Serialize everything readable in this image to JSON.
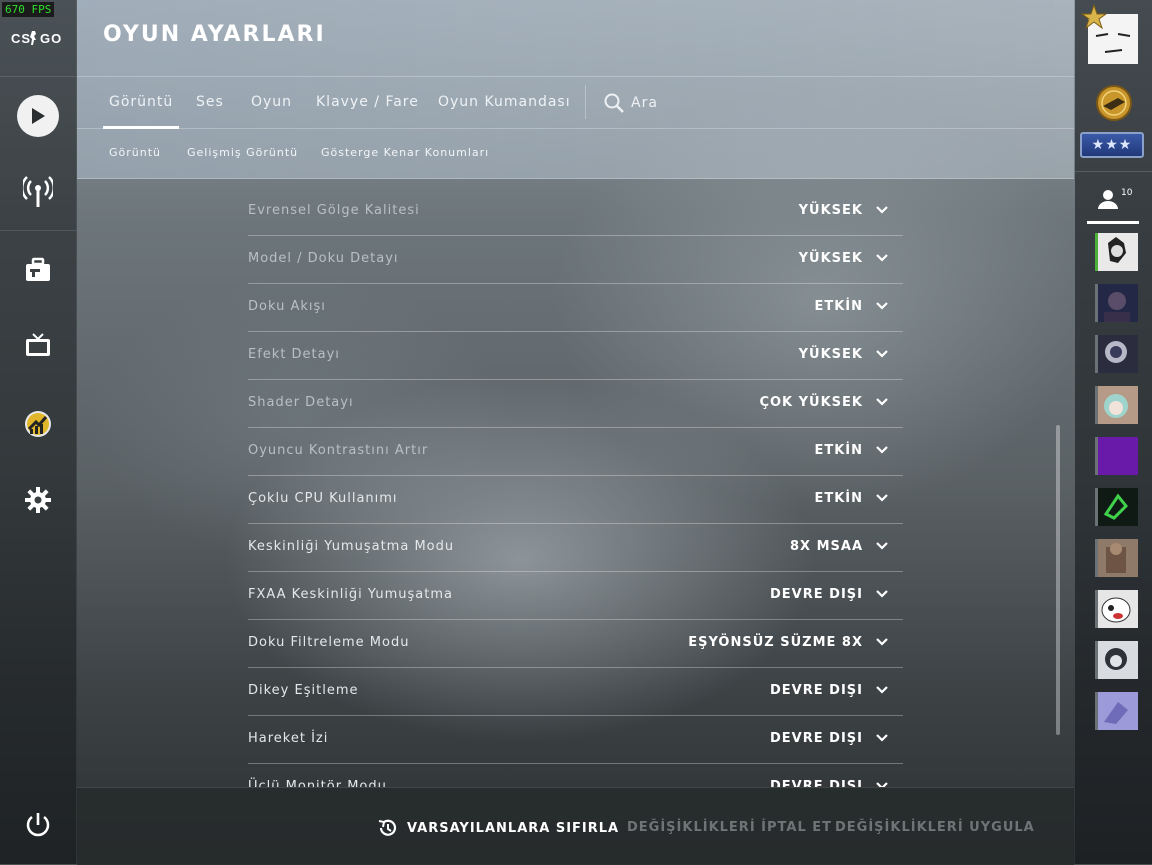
{
  "fps": "670 FPS",
  "logo": "CS GO",
  "header": {
    "title": "OYUN AYARLARI"
  },
  "tabs": [
    {
      "label": "Görüntü",
      "active": true
    },
    {
      "label": "Ses"
    },
    {
      "label": "Oyun"
    },
    {
      "label": "Klavye / Fare"
    },
    {
      "label": "Oyun Kumandası"
    }
  ],
  "search": {
    "label": "Ara"
  },
  "subtabs": [
    "Görüntü",
    "Gelişmiş Görüntü",
    "Gösterge Kenar Konumları"
  ],
  "settings": [
    {
      "label": "Evrensel Gölge Kalitesi",
      "value": "YÜKSEK"
    },
    {
      "label": "Model / Doku Detayı",
      "value": "YÜKSEK"
    },
    {
      "label": "Doku Akışı",
      "value": "ETKİN"
    },
    {
      "label": "Efekt Detayı",
      "value": "YÜKSEK"
    },
    {
      "label": "Shader Detayı",
      "value": "ÇOK YÜKSEK"
    },
    {
      "label": "Oyuncu Kontrastını Artır",
      "value": "ETKİN"
    },
    {
      "label": "Çoklu CPU Kullanımı",
      "value": "ETKİN"
    },
    {
      "label": "Keskinliği Yumuşatma Modu",
      "value": "8X MSAA"
    },
    {
      "label": "FXAA Keskinliği Yumuşatma",
      "value": "DEVRE DIŞI"
    },
    {
      "label": "Doku Filtreleme Modu",
      "value": "EŞYÖNSÜZ SÜZME 8X"
    },
    {
      "label": "Dikey Eşitleme",
      "value": "DEVRE DIŞI"
    },
    {
      "label": "Hareket İzi",
      "value": "DEVRE DIŞI"
    },
    {
      "label": "Üçlü Monitör Modu",
      "value": "DEVRE DIŞI"
    }
  ],
  "footer": {
    "reset": "VARSAYILANLARA SIFIRLA",
    "cancel": "DEĞİŞİKLİKLERİ İPTAL ET",
    "apply": "DEĞİŞİKLİKLERİ UYGULA"
  },
  "friends": {
    "count": "10"
  },
  "colors": {
    "fps_green": "#2ee02e",
    "disabled_text": "#6f7476",
    "rank_blue": "#2b4a96"
  }
}
